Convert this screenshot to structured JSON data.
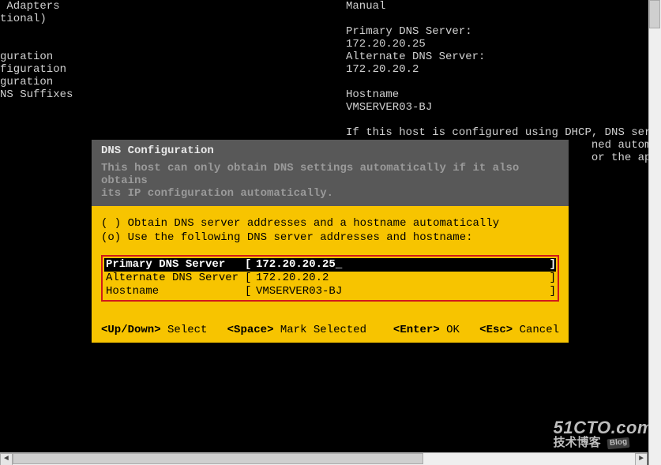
{
  "background": {
    "left_menu": " Adapters\ntional)\n\n\nguration\nfiguration\nguration\nNS Suffixes",
    "right_header": "Manual\n\nPrimary DNS Server:\n172.20.20.25\nAlternate DNS Server:\n172.20.20.2\n\nHostname\nVMSERVER03-BJ\n\nIf this host is configured using DHCP, DNS serve\n                                     ned automat\n                                     or the appro"
  },
  "dialog": {
    "title": "DNS Configuration",
    "description": "This host can only obtain DNS settings automatically if it also obtains\nits IP configuration automatically.",
    "radio_auto": {
      "mark": "( )",
      "label": "Obtain DNS server addresses and a hostname automatically"
    },
    "radio_manual": {
      "mark": "(o)",
      "label": "Use the following DNS server addresses and hostname:"
    },
    "fields": {
      "primary": {
        "label": "Primary DNS Server",
        "value": "172.20.20.25_"
      },
      "alternate": {
        "label": "Alternate DNS Server",
        "value": "172.20.20.2"
      },
      "hostname": {
        "label": "Hostname",
        "value": "VMSERVER03-BJ"
      },
      "bracket_open": "[",
      "bracket_close": "]"
    },
    "footer": {
      "updown_key": "<Up/Down>",
      "updown_label": " Select",
      "space_key": "<Space>",
      "space_label": " Mark Selected",
      "enter_key": "<Enter>",
      "enter_label": " OK",
      "esc_key": "<Esc>",
      "esc_label": " Cancel"
    }
  },
  "watermark": {
    "line1": "51CTO.com",
    "line2": "技术博客",
    "badge": "Blog"
  }
}
